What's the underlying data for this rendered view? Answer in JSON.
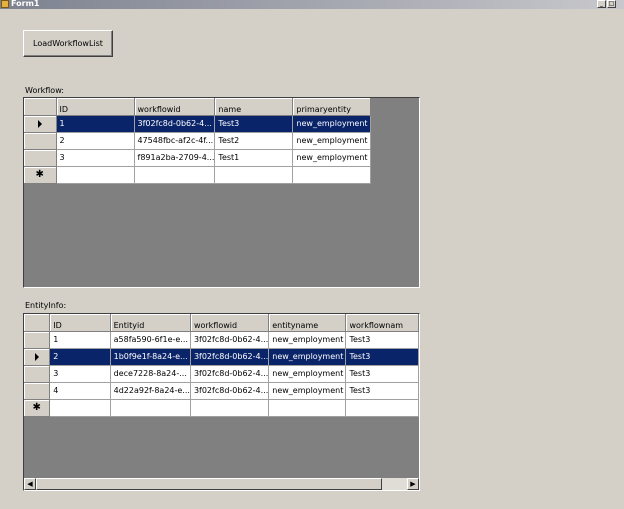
{
  "window": {
    "title": "Form1",
    "min_glyph": "_",
    "close_glyph": "□"
  },
  "load_button": {
    "label": "LoadWorkflowList"
  },
  "workflow": {
    "label": "Workflow:",
    "columns": [
      "ID",
      "workflowid",
      "name",
      "primaryentity"
    ],
    "rows": [
      [
        "1",
        "3f02fc8d-0b62-4...",
        "Test3",
        "new_employment"
      ],
      [
        "2",
        "47548fbc-af2c-4f...",
        "Test2",
        "new_employment"
      ],
      [
        "3",
        "f891a2ba-2709-4...",
        "Test1",
        "new_employment"
      ]
    ],
    "selected_row": 0,
    "new_row_glyph": "✱",
    "current_row_glyph": "▶"
  },
  "entity": {
    "label": "EntityInfo:",
    "columns": [
      "ID",
      "Entityid",
      "workflowid",
      "entityname",
      "workflownam"
    ],
    "rows": [
      [
        "1",
        "a58fa590-6f1e-e...",
        "3f02fc8d-0b62-4...",
        "new_employment",
        "Test3"
      ],
      [
        "2",
        "1b0f9e1f-8a24-e...",
        "3f02fc8d-0b62-4...",
        "new_employment",
        "Test3"
      ],
      [
        "3",
        "dece7228-8a24-...",
        "3f02fc8d-0b62-4...",
        "new_employment",
        "Test3"
      ],
      [
        "4",
        "4d22a92f-8a24-e...",
        "3f02fc8d-0b62-4...",
        "new_employment",
        "Test3"
      ]
    ],
    "selected_row": 1,
    "new_row_glyph": "✱",
    "scroll_left_glyph": "◀",
    "scroll_right_glyph": "▶"
  }
}
